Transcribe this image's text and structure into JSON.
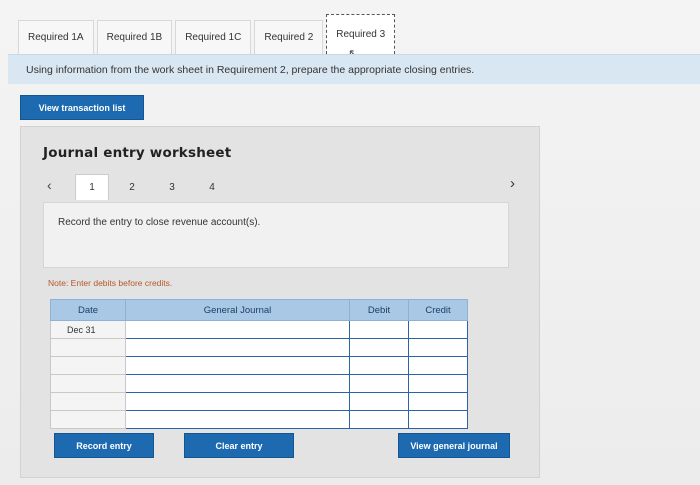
{
  "tabs": [
    {
      "label": "Required 1A",
      "active": false
    },
    {
      "label": "Required 1B",
      "active": false
    },
    {
      "label": "Required 1C",
      "active": false
    },
    {
      "label": "Required 2",
      "active": false
    },
    {
      "label": "Required 3",
      "active": true
    }
  ],
  "instruction": "Using information from the work sheet in Requirement 2, prepare the appropriate closing entries.",
  "view_transaction_list": "View transaction list",
  "worksheet": {
    "title": "Journal entry worksheet",
    "pages": [
      "1",
      "2",
      "3",
      "4"
    ],
    "active_page": "1",
    "prompt": "Record the entry to close revenue account(s).",
    "note": "Note: Enter debits before credits.",
    "columns": {
      "date": "Date",
      "general_journal": "General Journal",
      "debit": "Debit",
      "credit": "Credit"
    },
    "rows": [
      {
        "date": "Dec 31",
        "account": "",
        "debit": "",
        "credit": ""
      },
      {
        "date": "",
        "account": "",
        "debit": "",
        "credit": ""
      },
      {
        "date": "",
        "account": "",
        "debit": "",
        "credit": ""
      },
      {
        "date": "",
        "account": "",
        "debit": "",
        "credit": ""
      },
      {
        "date": "",
        "account": "",
        "debit": "",
        "credit": ""
      },
      {
        "date": "",
        "account": "",
        "debit": "",
        "credit": ""
      }
    ],
    "buttons": {
      "record": "Record entry",
      "clear": "Clear entry",
      "view_general_journal": "View general journal"
    }
  },
  "colors": {
    "accent": "#1d6ab1",
    "header": "#a9c8e6",
    "note": "#b5572a"
  }
}
